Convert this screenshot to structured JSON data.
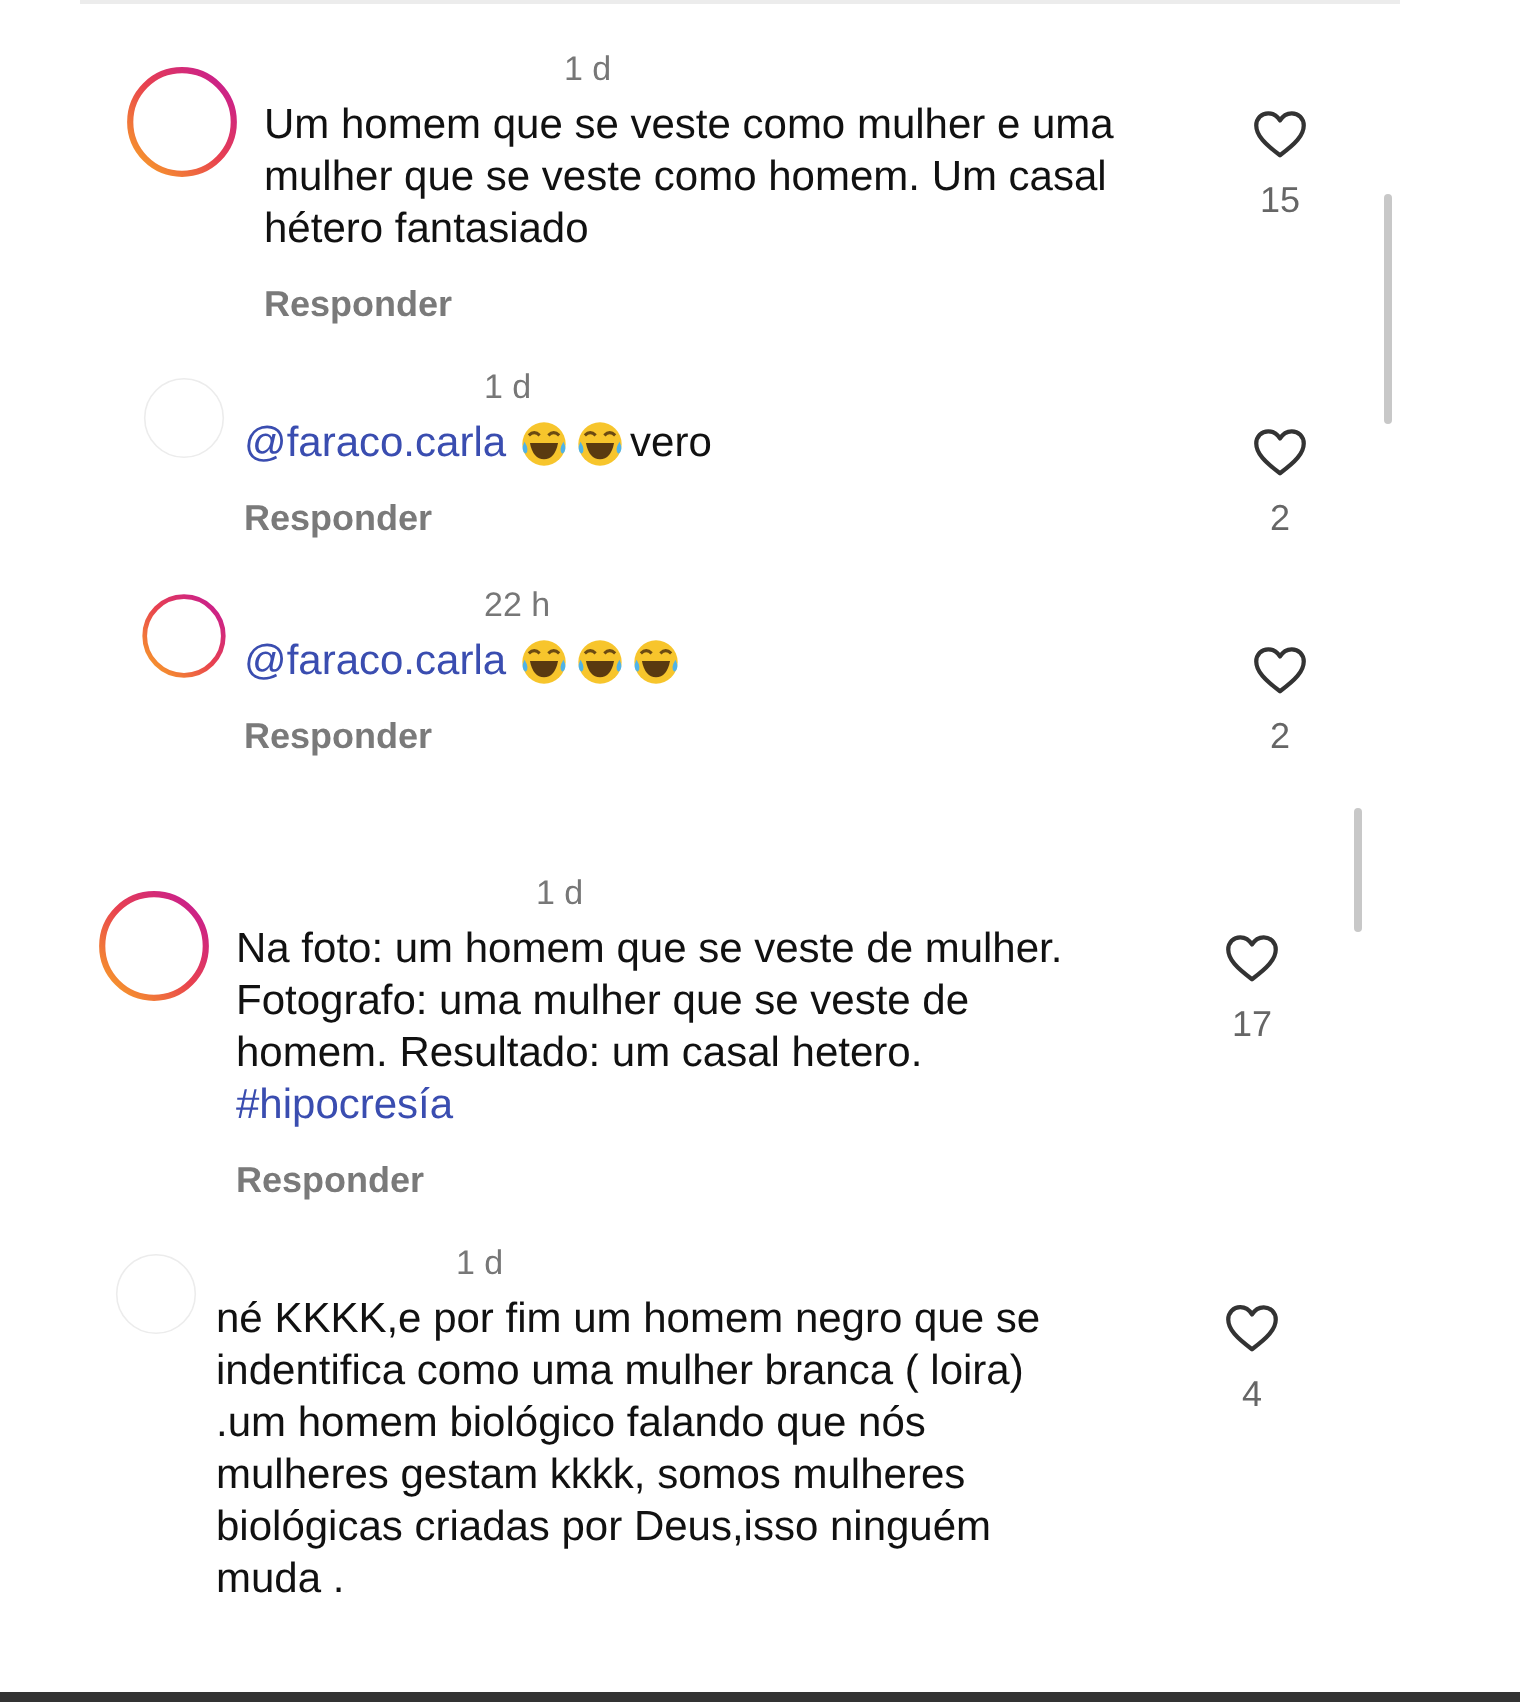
{
  "sections": [
    {
      "comments": [
        {
          "kind": "top",
          "story_ring": true,
          "time": "1 d",
          "body": [
            {
              "kind": "text",
              "text": "Um homem que se veste como mulher e uma mulher que se veste como homem. Um casal hétero fantasiado"
            }
          ],
          "reply_label": "Responder",
          "likes": "15"
        },
        {
          "kind": "reply",
          "story_ring": false,
          "time": "1 d",
          "body": [
            {
              "kind": "mention",
              "text": "@faraco.carla"
            },
            {
              "kind": "emoji"
            },
            {
              "kind": "emoji"
            },
            {
              "kind": "text",
              "text": "vero"
            }
          ],
          "reply_label": "Responder",
          "likes": "2"
        },
        {
          "kind": "reply",
          "story_ring": true,
          "time": "22 h",
          "body": [
            {
              "kind": "mention",
              "text": "@faraco.carla"
            },
            {
              "kind": "emoji"
            },
            {
              "kind": "emoji"
            },
            {
              "kind": "emoji"
            }
          ],
          "reply_label": "Responder",
          "likes": "2"
        }
      ]
    },
    {
      "comments": [
        {
          "kind": "top",
          "story_ring": true,
          "time": "1 d",
          "body": [
            {
              "kind": "text",
              "text": "Na foto: um homem que se veste de mulher. Fotografo: uma mulher que se veste de homem. Resultado: um casal hetero."
            },
            {
              "kind": "hashtag",
              "text": "#hipocresía"
            }
          ],
          "reply_label": "Responder",
          "likes": "17"
        },
        {
          "kind": "reply",
          "story_ring": false,
          "time": "1 d",
          "body": [
            {
              "kind": "text",
              "text": "né KKKK,e por fim um homem negro que se indentifica como uma mulher branca ( loira) .um homem biológico falando que nós mulheres gestam kkkk, somos mulheres biológicas criadas por Deus,isso ninguém muda ."
            }
          ],
          "likes": "4"
        }
      ]
    }
  ]
}
